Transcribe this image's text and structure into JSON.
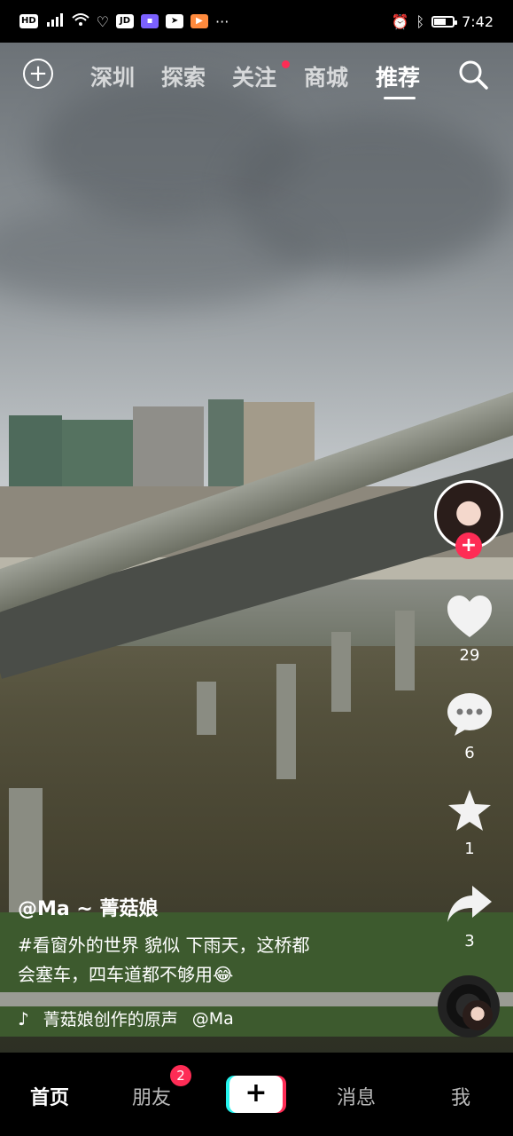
{
  "status_bar": {
    "left_icons": [
      "hd-icon",
      "5g-signal-icon",
      "wifi-icon",
      "health-icon",
      "jd-icon",
      "app-icon-1",
      "app-icon-2",
      "app-icon-3"
    ],
    "hd": "HD",
    "more": "···",
    "time": "7:42"
  },
  "top_nav": {
    "tabs": [
      "深圳",
      "探索",
      "关注",
      "商城",
      "推荐"
    ],
    "active_tab": "推荐"
  },
  "actions": {
    "like_count": "29",
    "comment_count": "6",
    "favorite_count": "1",
    "share_count": "3"
  },
  "post": {
    "author": "@Ma ~ 菁菇娘",
    "caption_line1": "#看窗外的世界  貌似 下雨天，这桥都",
    "caption_line2": "会塞车，四车道都不够用😂",
    "music_title": "菁菇娘创作的原声",
    "music_author": "@Ma"
  },
  "bottom_nav": {
    "home": "首页",
    "friends": "朋友",
    "friends_badge": "2",
    "create": "+",
    "messages": "消息",
    "me": "我"
  },
  "colors": {
    "accent": "#fe2c55",
    "cyan": "#25f4ee"
  }
}
